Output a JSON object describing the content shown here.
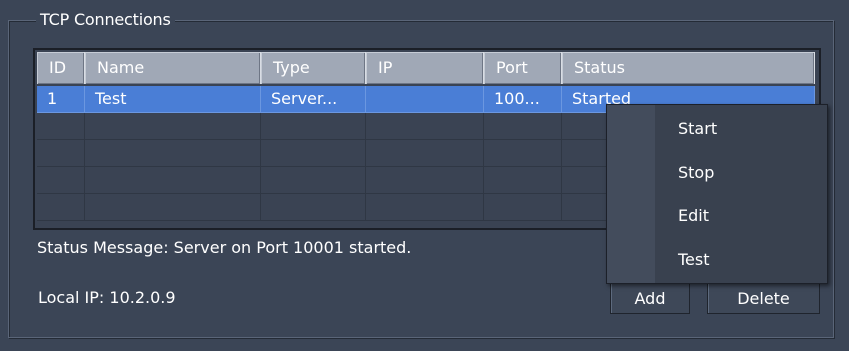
{
  "group": {
    "title": "TCP Connections"
  },
  "table": {
    "columns": [
      "ID",
      "Name",
      "Type",
      "IP",
      "Port",
      "Status"
    ],
    "rows": [
      {
        "id": "1",
        "name": "Test",
        "type": "Server...",
        "ip": "",
        "port": "100...",
        "status": "Started"
      }
    ]
  },
  "status": {
    "message": "Status Message:  Server on Port 10001 started."
  },
  "local": {
    "ip": "Local IP:  10.2.0.9"
  },
  "buttons": {
    "add": "Add",
    "delete": "Delete"
  },
  "context_menu": {
    "items": [
      "Start",
      "Stop",
      "Edit",
      "Test"
    ]
  },
  "colors": {
    "background": "#3b4556",
    "selection": "#4a7ed6",
    "header": "#a0a8b6"
  }
}
